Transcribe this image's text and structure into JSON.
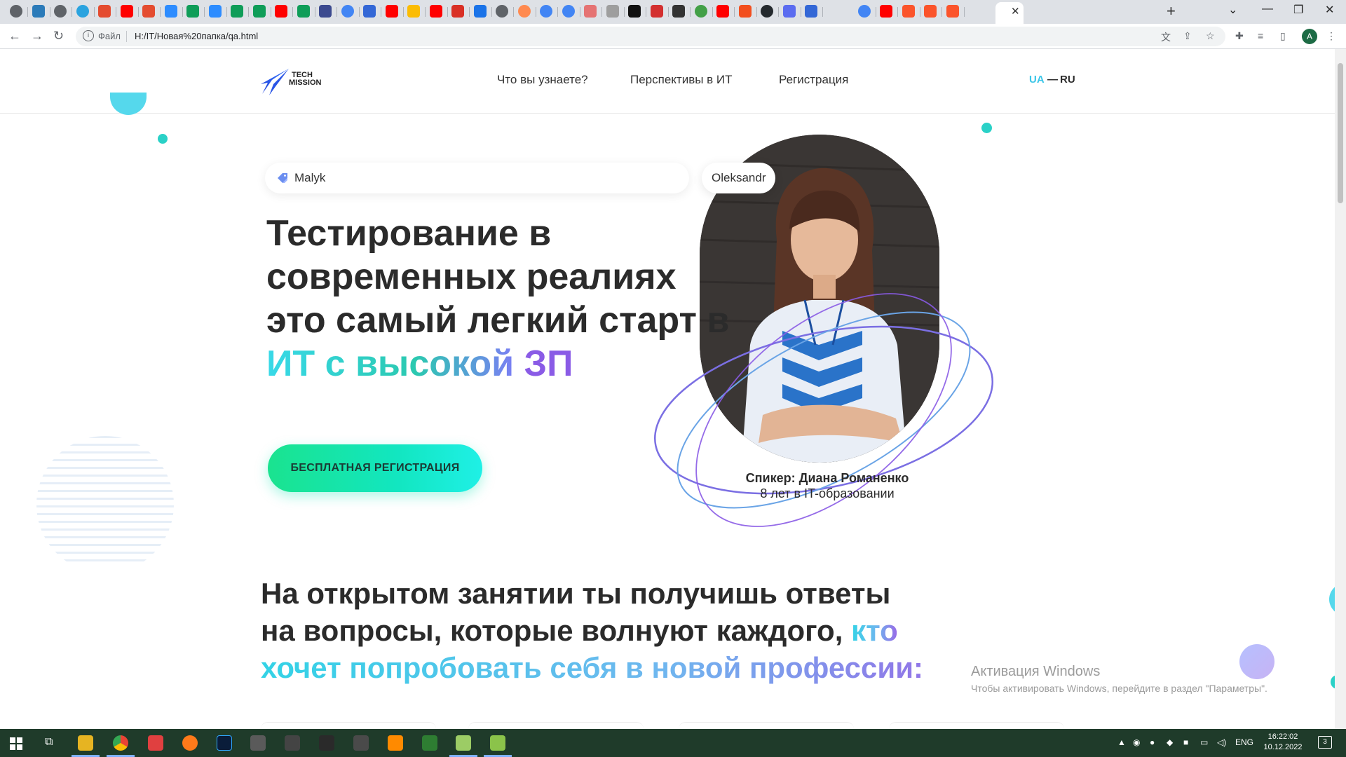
{
  "browser": {
    "tabs_favicons": [
      "chrome-icon",
      "r-icon",
      "globe-icon",
      "telegram-icon",
      "git-icon",
      "youtube-icon",
      "git-icon",
      "zoom-icon",
      "sheets-icon",
      "zoom-icon",
      "sheets-icon",
      "sheets-icon",
      "youtube-icon",
      "sheets-icon",
      "calc-icon",
      "maps-icon",
      "pen-icon",
      "youtube-icon",
      "drive-icon",
      "youtube-icon",
      "gmail-icon",
      "ads-icon",
      "globe-icon",
      "pinwheel-icon",
      "google-icon",
      "google-icon",
      "cake-icon",
      "code-icon",
      "cn-icon",
      "x-icon",
      "wiki-icon",
      "alarm-icon",
      "youtube-icon",
      "figma-icon",
      "github-icon",
      "sb-icon",
      "pen-icon",
      "active-tab",
      "google-icon",
      "youtube-icon",
      "brave-icon",
      "brave-icon",
      "brave-icon"
    ],
    "active_tab_close": "✕",
    "new_tab": "+",
    "address": {
      "file_label": "Файл",
      "url": "H:/IT/Новая%20папка/qa.html"
    },
    "profile_initial": "A"
  },
  "site": {
    "logo_line1": "TECH",
    "logo_line2": "MISSION",
    "nav": [
      "Что вы узнаете?",
      "Перспективы в ИТ",
      "Регистрация"
    ],
    "lang_ua": "UA",
    "lang_dash": "—",
    "lang_ru": "RU"
  },
  "hero": {
    "first_name_tag": "Malyk",
    "second_name_tag": "Oleksandr",
    "title_line1": "Тестирование в",
    "title_line2": "современных реалиях",
    "title_line3": "это самый легкий старт в",
    "accent_part1": "ИТ с высокой",
    "accent_part2": "ЗП",
    "cta": "БЕСПЛАТНАЯ РЕГИСТРАЦИЯ",
    "speaker_name": "Спикер: Диана Романенко",
    "speaker_experience": "8 лет в IT-образовании"
  },
  "section": {
    "title_line1": "На открытом занятии ты получишь ответы",
    "title_line2_plain": "на вопросы, которые волнуют каждого, ",
    "title_line2_accent": "кто",
    "title_line3_accent": "хочет попробовать себя в новой профессии:"
  },
  "os": {
    "watermark_title": "Активация Windows",
    "watermark_text": "Чтобы активировать Windows, перейдите в раздел \"Параметры\".",
    "lang": "ENG",
    "time": "16:22:02",
    "date": "10.12.2022",
    "notifications": "3"
  },
  "colors": {
    "accent_cyan": "#38d9e8",
    "accent_green": "#1ae38f",
    "accent_purple": "#8a5be6",
    "orbit": "#7f78e6",
    "taskbar": "#1f3b2a"
  }
}
